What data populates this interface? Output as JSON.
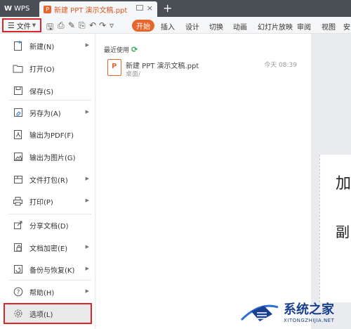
{
  "titlebar": {
    "app_tab": "WPS",
    "doc_tab_title": "新建 PPT 演示文稿.ppt",
    "ppt_badge": "P",
    "close": "×",
    "new_tab": "+"
  },
  "ribbon": {
    "file_label": "文件",
    "tabs": [
      "开始",
      "插入",
      "设计",
      "切换",
      "动画",
      "幻灯片放映",
      "审阅",
      "视图",
      "安"
    ]
  },
  "menu": {
    "items": [
      {
        "label": "新建(N)",
        "icon": "new-file-icon",
        "has_submenu": true
      },
      {
        "label": "打开(O)",
        "icon": "folder-icon",
        "has_submenu": false
      },
      {
        "label": "保存(S)",
        "icon": "save-icon",
        "has_submenu": false
      },
      {
        "label": "另存为(A)",
        "icon": "save-as-icon",
        "has_submenu": true
      },
      {
        "label": "输出为PDF(F)",
        "icon": "pdf-icon",
        "has_submenu": false
      },
      {
        "label": "输出为图片(G)",
        "icon": "image-export-icon",
        "has_submenu": false
      },
      {
        "label": "文件打包(R)",
        "icon": "package-icon",
        "has_submenu": true
      },
      {
        "label": "打印(P)",
        "icon": "printer-icon",
        "has_submenu": true
      },
      {
        "label": "分享文档(D)",
        "icon": "share-icon",
        "has_submenu": false
      },
      {
        "label": "文档加密(E)",
        "icon": "lock-icon",
        "has_submenu": true
      },
      {
        "label": "备份与恢复(K)",
        "icon": "backup-icon",
        "has_submenu": true
      },
      {
        "label": "帮助(H)",
        "icon": "help-icon",
        "has_submenu": true
      },
      {
        "label": "选项(L)",
        "icon": "gear-icon",
        "has_submenu": false
      }
    ]
  },
  "recent": {
    "title": "最近使用",
    "files": [
      {
        "name": "新建 PPT 演示文稿.ppt",
        "path": "桌面/",
        "time": "今天 08:39"
      }
    ]
  },
  "doc_background": {
    "chunk1": "加",
    "chunk2": "副"
  },
  "watermark": {
    "brand": "系统之家",
    "url": "XITONGZHIJIA.NET"
  }
}
